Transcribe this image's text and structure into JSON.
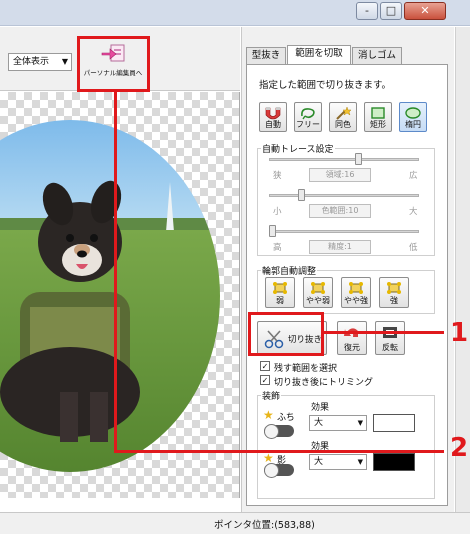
{
  "window": {
    "minimize_label": "-",
    "maximize_label": "□",
    "close_label": "✕"
  },
  "toolbar": {
    "zoom_value": "全体表示",
    "partial_edit_label": "パーソナル編集員へ"
  },
  "tabs": [
    {
      "label": "型抜き"
    },
    {
      "label": "範囲を切取"
    },
    {
      "label": "消しゴム"
    }
  ],
  "panel": {
    "instruction": "指定した範囲で切り抜きます。",
    "tools": [
      {
        "label": "自動"
      },
      {
        "label": "フリー"
      },
      {
        "label": "同色"
      },
      {
        "label": "矩形"
      },
      {
        "label": "楕円"
      }
    ],
    "auto_trace": {
      "title": "自動トレース設定",
      "rows": [
        {
          "left": "狭",
          "field": "領域:16",
          "right": "広",
          "level": 0.6
        },
        {
          "left": "小",
          "field": "色範囲:10",
          "right": "大",
          "level": 0.2
        },
        {
          "left": "高",
          "field": "精度:1",
          "right": "低",
          "level": 0.0
        }
      ]
    },
    "contour": {
      "title": "輪郭自動調整",
      "buttons": [
        {
          "label": "弱"
        },
        {
          "label": "やや弱"
        },
        {
          "label": "やや強"
        },
        {
          "label": "強"
        }
      ]
    },
    "cut_button": "切り抜き",
    "restore_button": "復元",
    "invert_button": "反転",
    "checkboxes": [
      {
        "label": "残す範囲を選択",
        "checked": true
      },
      {
        "label": "切り抜き後にトリミング",
        "checked": true
      }
    ],
    "decoration": {
      "title": "装飾",
      "items": [
        {
          "name": "ふち",
          "effect_label": "効果",
          "effect_value": "大",
          "color": "#ffffff"
        },
        {
          "name": "影",
          "effect_label": "効果",
          "effect_value": "大",
          "color": "#000000"
        }
      ]
    }
  },
  "status": {
    "pointer_position": "ポインタ位置:(583,88)"
  },
  "callouts": [
    {
      "number": "1"
    },
    {
      "number": "2"
    }
  ],
  "colors": {
    "callout_red": "#e0191c",
    "selected_tool": "#c6dcf5"
  }
}
